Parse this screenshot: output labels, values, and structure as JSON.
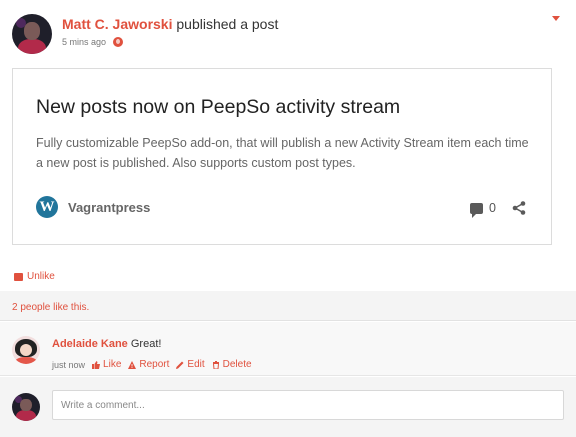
{
  "post": {
    "author_name": "Matt C. Jaworski",
    "action_text": "published a post",
    "time": "5 mins ago",
    "privacy_icon": "globe-icon",
    "menu_icon": "chevron-down-icon"
  },
  "embed": {
    "title": "New posts now on PeepSo activity stream",
    "description": "Fully customizable PeepSo add-on, that will publish a new Activity Stream item each time a new post is published. Also supports custom post types.",
    "site_icon": "wordpress-icon",
    "site_name": "Vagrantpress",
    "comment_count": "0",
    "share_icon": "share-icon"
  },
  "reactions": {
    "unlike_label": "Unlike",
    "likes_text": "2 people like this."
  },
  "comment": {
    "author_name": "Adelaide Kane",
    "text": "Great!",
    "time": "just now",
    "actions": {
      "like": "Like",
      "report": "Report",
      "edit": "Edit",
      "delete": "Delete"
    }
  },
  "composer": {
    "placeholder": "Write a comment..."
  },
  "colors": {
    "accent": "#e0513e",
    "wordpress": "#21759b"
  }
}
